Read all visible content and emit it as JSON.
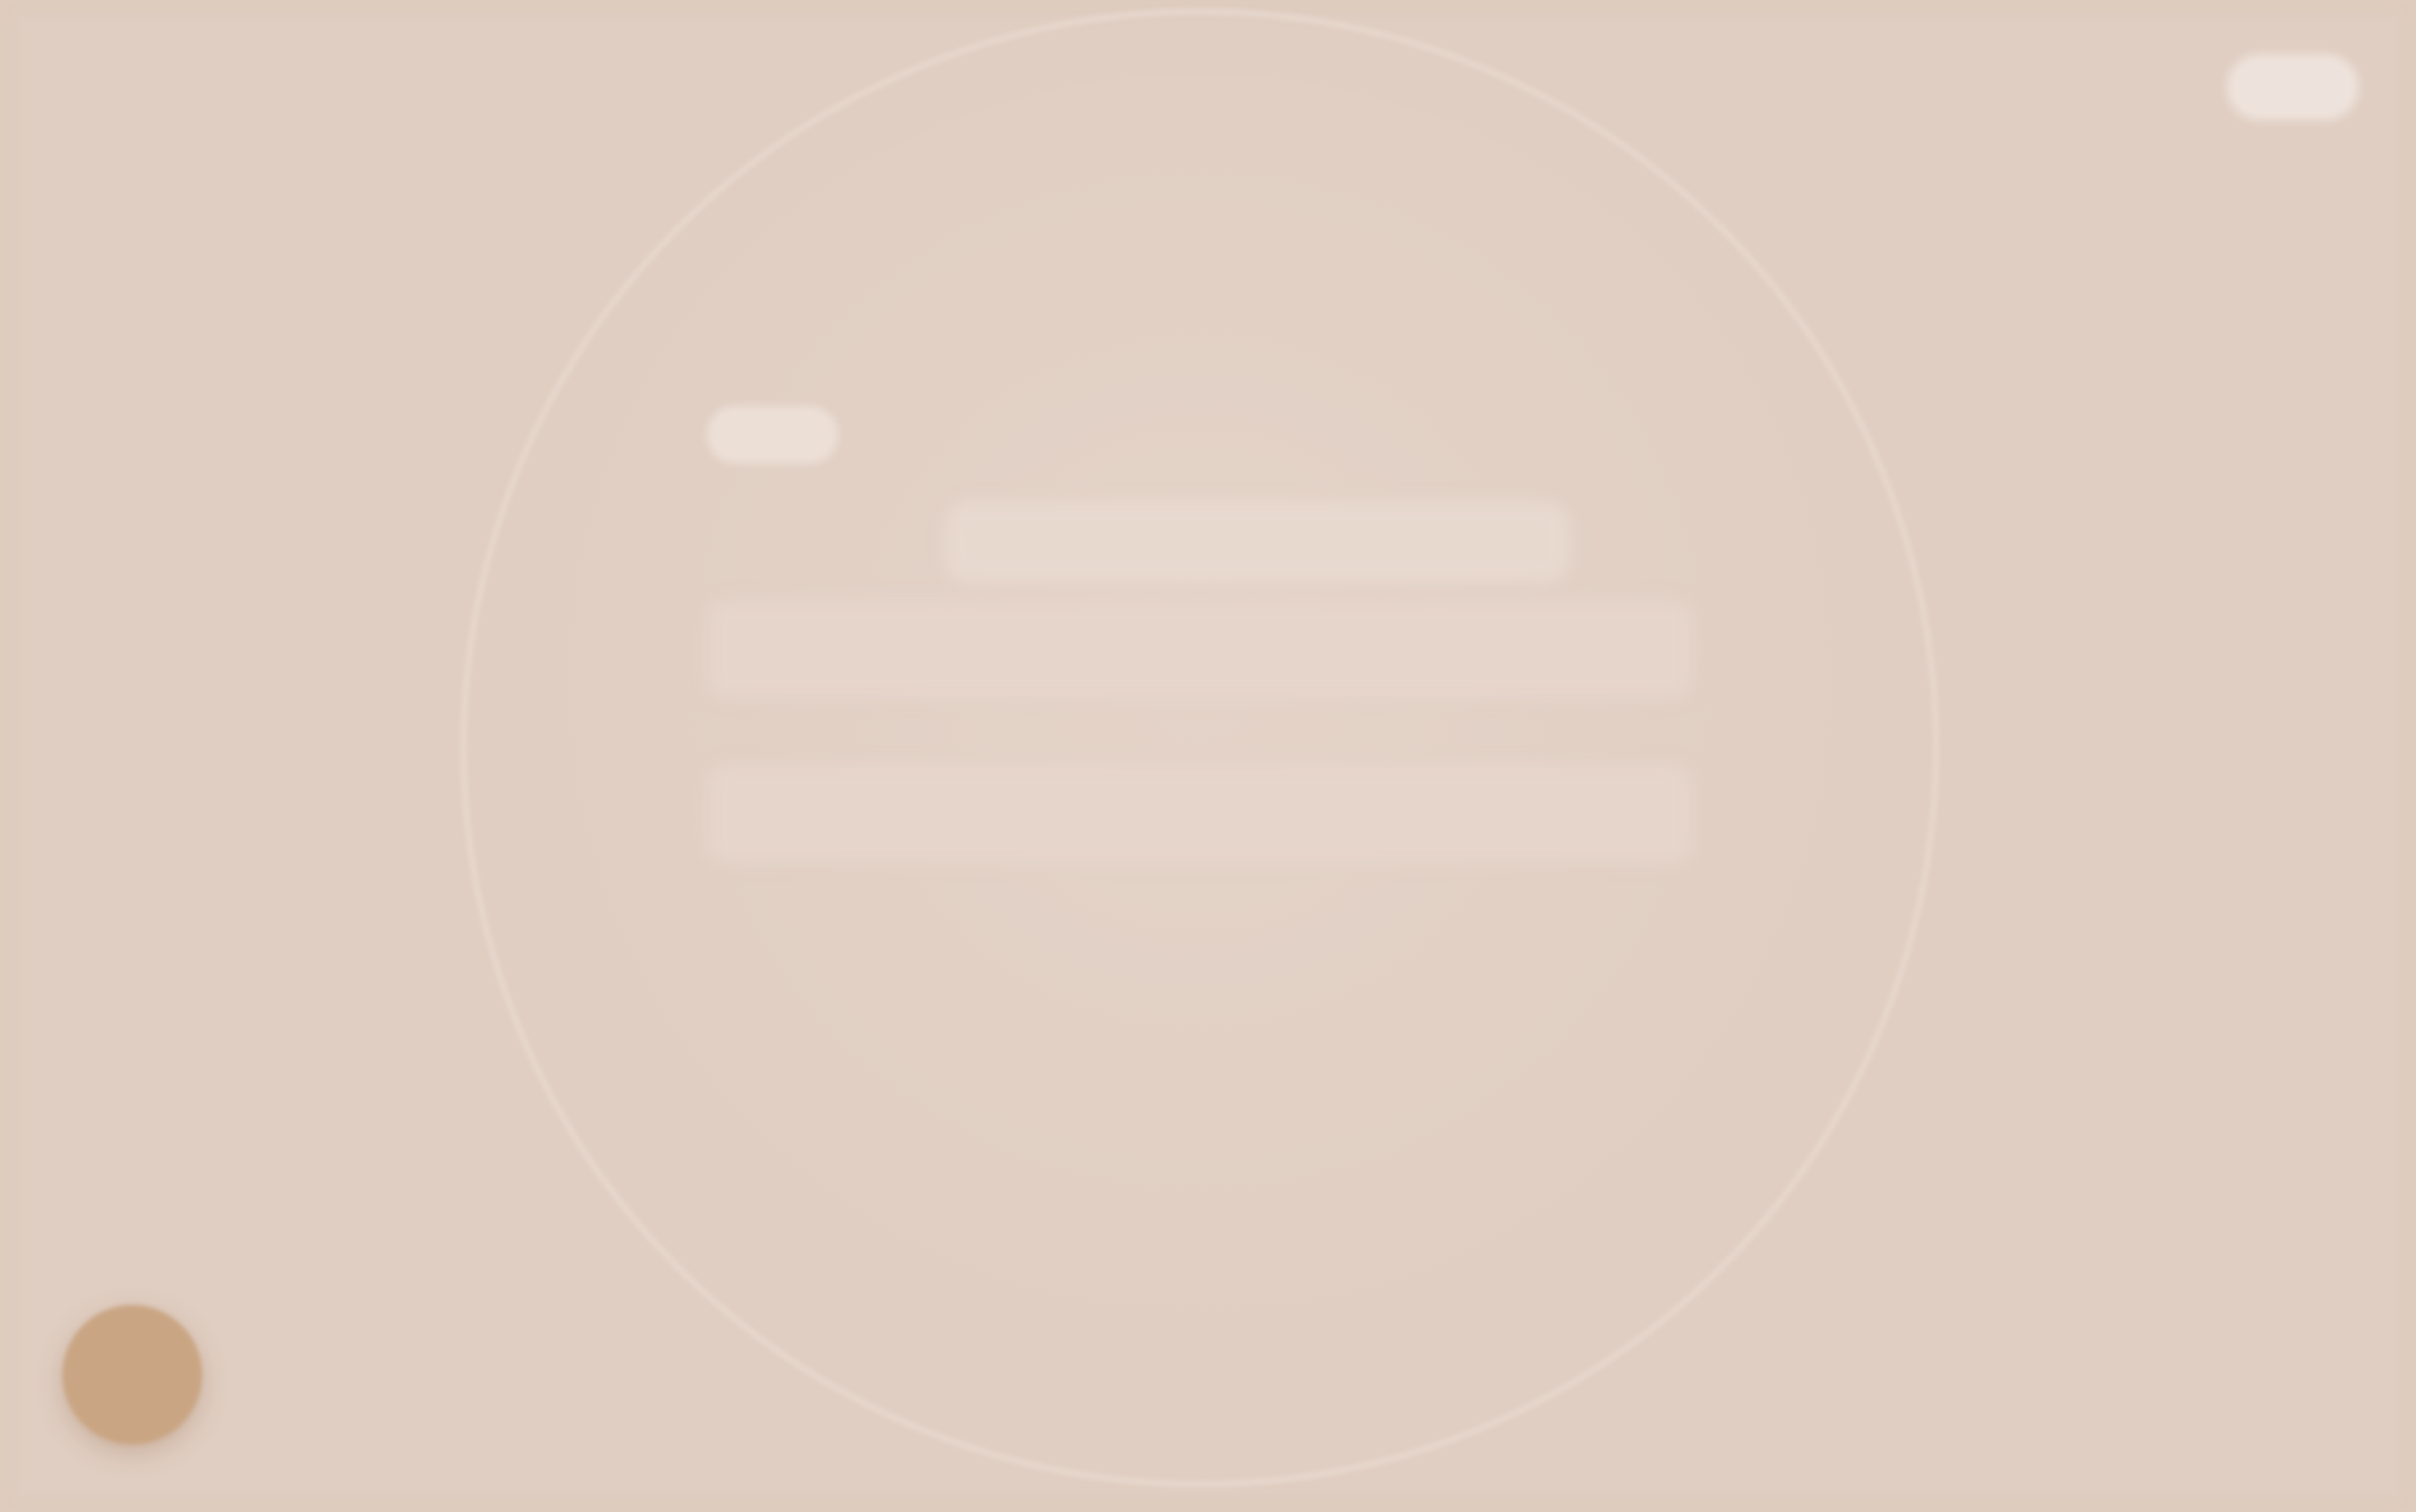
{
  "header": {
    "title": "",
    "action_label": ""
  },
  "card": {
    "tag": "",
    "heading": "",
    "paragraphs": [
      "",
      "",
      ""
    ],
    "footnote": ""
  },
  "avatar": {
    "icon": "user-avatar-icon",
    "initials": ""
  },
  "colors": {
    "background": "#e0cec2",
    "accent": "#c9a583",
    "text_dark": "#5f534d",
    "text_muted": "#8f827b"
  }
}
